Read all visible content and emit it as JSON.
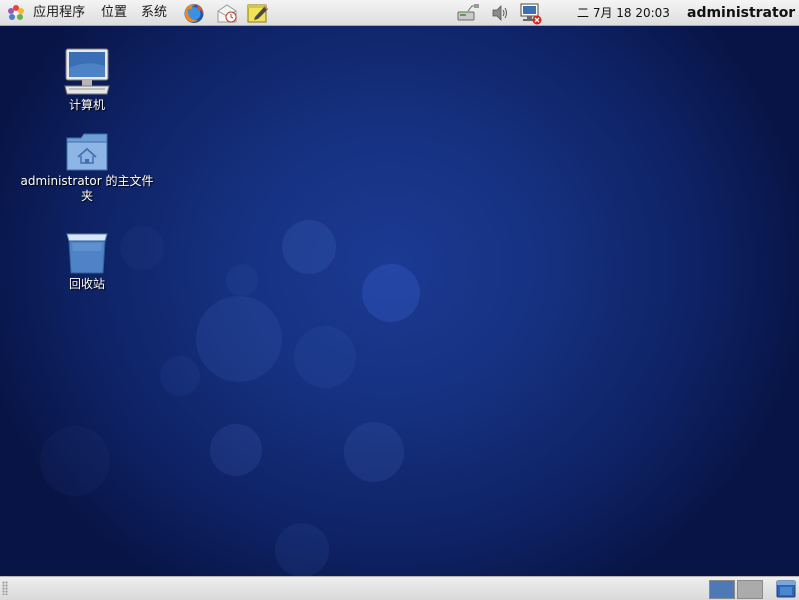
{
  "top_panel": {
    "menus": {
      "applications": "应用程序",
      "places": "位置",
      "system": "系统"
    },
    "launchers": [
      "firefox-icon",
      "mail-client-icon",
      "text-editor-icon"
    ],
    "tray": [
      "network-icon",
      "volume-icon",
      "network-disconnected-icon"
    ],
    "clock": "二 7月 18 20:03",
    "user": "administrator"
  },
  "desktop": {
    "icons": [
      {
        "label": "计算机",
        "icon": "computer-icon"
      },
      {
        "label": "administrator 的主文件夹",
        "icon": "home-folder-icon"
      },
      {
        "label": "回收站",
        "icon": "trash-icon"
      }
    ]
  },
  "bottom_panel": {
    "workspaces": [
      {
        "active": true,
        "color": "#4f79b6"
      },
      {
        "active": false,
        "color": "#ababab"
      }
    ]
  },
  "colors": {
    "desktop_bg": "#15307e",
    "panel_bg": "#e6e6e6",
    "workspace_active": "#4f79b6"
  }
}
